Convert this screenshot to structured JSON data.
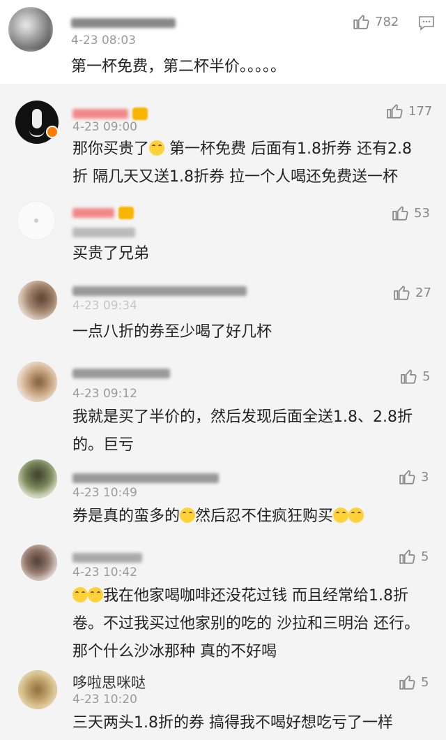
{
  "main_comment": {
    "time": "4-23 08:03",
    "text": "第一杯免费，第二杯半价。。。。。",
    "likes": "782"
  },
  "replies": [
    {
      "time": "4-23 09:00",
      "text1": "那你买贵了",
      "text2": "第一杯免费  后面有1.8折券  还有2.8",
      "text3": "折  隔几天又送1.8折券  拉一个人喝还免费送一杯",
      "likes": "177"
    },
    {
      "time": "",
      "text": "买贵了兄弟",
      "likes": "53"
    },
    {
      "time": "4-23 09:34",
      "text": "一点八折的券至少喝了好几杯",
      "likes": "27"
    },
    {
      "time": "4-23 09:12",
      "line1": "我就是买了半价的，然后发现后面全送1.8、2.8折",
      "line2": "的。巨亏",
      "likes": "5"
    },
    {
      "time": "4-23 10:49",
      "a": "券是真的蛮多的",
      "b": "然后忍不住疯狂购买",
      "likes": "3"
    },
    {
      "time": "4-23 10:42",
      "line1": "我在他家喝咖啡还没花过钱  而且经常给1.8折",
      "line2": "卷。不过我买过他家别的吃的  沙拉和三明治  还行。",
      "line3": "那个什么沙冰那种  真的不好喝",
      "likes": "5"
    },
    {
      "name": "哆啦思咪哒",
      "time": "4-23 10:20",
      "text": "三天两头1.8折的券  搞得我不喝好想吃亏了一样",
      "likes": "5"
    }
  ],
  "icons": {
    "like": "thumbs-up-icon",
    "comment": "comment-icon",
    "emoji": "laughing-emoji"
  },
  "colors": {
    "reply_bg": "#f4f4f4",
    "time": "#9a9a9a",
    "icon": "#888888"
  }
}
